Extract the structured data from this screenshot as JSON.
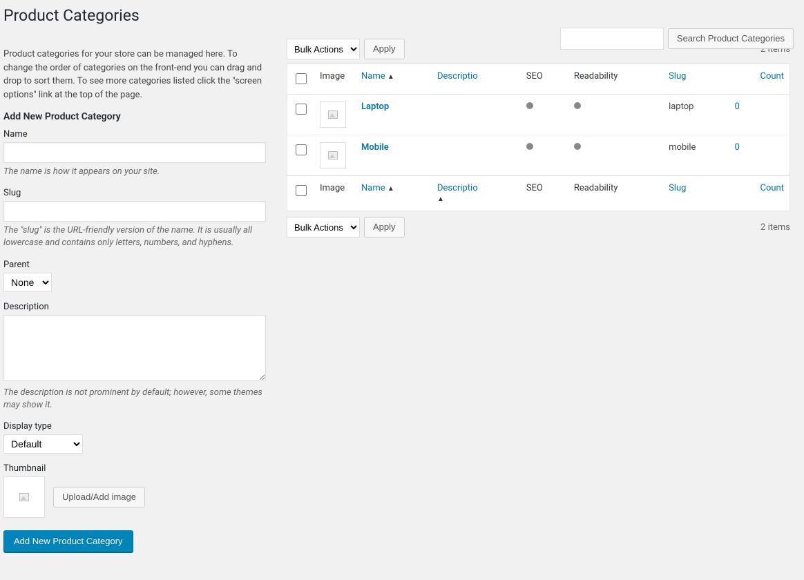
{
  "page_title": "Product Categories",
  "search": {
    "button": "Search Product Categories"
  },
  "intro": "Product categories for your store can be managed here. To change the order of categories on the front-end you can drag and drop to sort them. To see more categories listed click the \"screen options\" link at the top of the page.",
  "form": {
    "heading": "Add New Product Category",
    "name_label": "Name",
    "name_help": "The name is how it appears on your site.",
    "slug_label": "Slug",
    "slug_help": "The \"slug\" is the URL-friendly version of the name. It is usually all lowercase and contains only letters, numbers, and hyphens.",
    "parent_label": "Parent",
    "parent_option": "None",
    "desc_label": "Description",
    "desc_help": "The description is not prominent by default; however, some themes may show it.",
    "display_label": "Display type",
    "display_option": "Default",
    "thumb_label": "Thumbnail",
    "upload_button": "Upload/Add image",
    "submit": "Add New Product Category"
  },
  "tablenav": {
    "bulk_label": "Bulk Actions",
    "apply": "Apply",
    "items": "2 items"
  },
  "columns": {
    "image": "Image",
    "name": "Name",
    "description": "Descriptio",
    "seo": "SEO",
    "readability": "Readability",
    "slug": "Slug",
    "count": "Count"
  },
  "rows": [
    {
      "name": "Laptop",
      "slug": "laptop",
      "count": "0"
    },
    {
      "name": "Mobile",
      "slug": "mobile",
      "count": "0"
    }
  ]
}
